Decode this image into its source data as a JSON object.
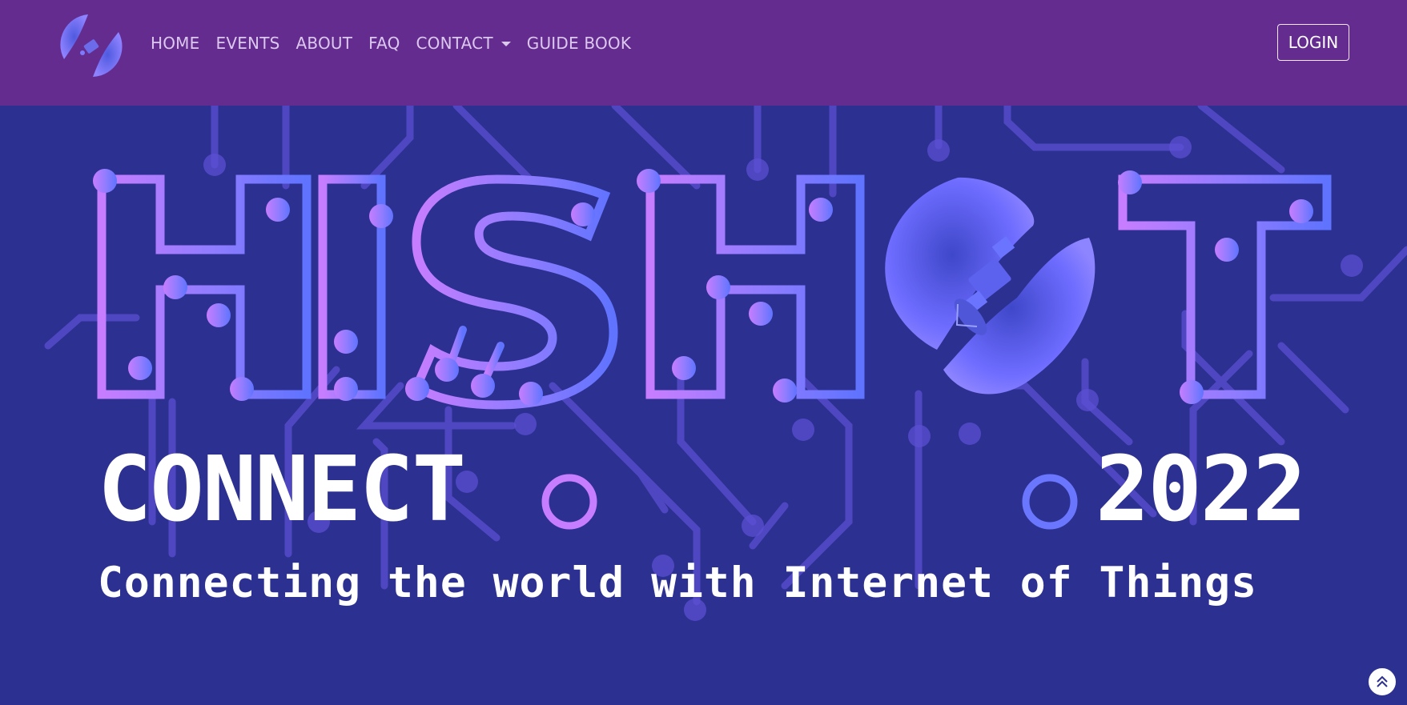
{
  "nav": {
    "logo_icon": "satellite-logo-icon",
    "links": [
      {
        "label": "HOME"
      },
      {
        "label": "EVENTS"
      },
      {
        "label": "ABOUT"
      },
      {
        "label": "FAQ"
      },
      {
        "label": "CONTACT"
      },
      {
        "label": "GUIDE BOOK"
      }
    ],
    "login_label": "LOGIN"
  },
  "hero": {
    "title": "HISHOT",
    "subtitle_left": "CONNECT",
    "subtitle_right": "2022",
    "tagline": "Connecting the world with Internet of Things"
  },
  "colors": {
    "navbar": "#652c8f",
    "background": "#2c3091",
    "accent_pink": "#c77dff",
    "accent_blue": "#6b76ff"
  },
  "scroll_top_icon": "double-chevron-up-icon"
}
